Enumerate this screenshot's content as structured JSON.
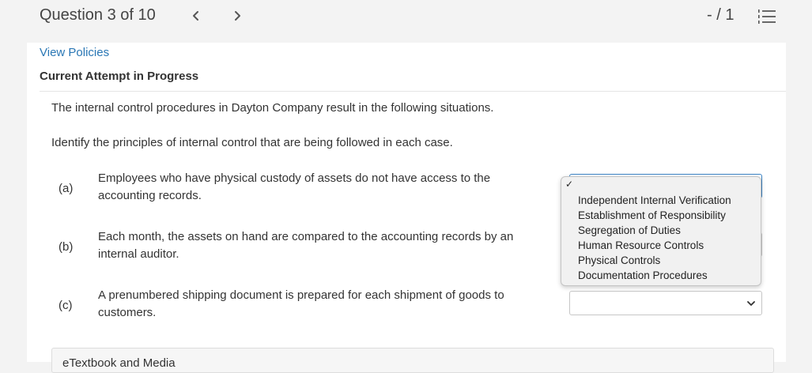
{
  "header": {
    "question_counter": "Question 3 of 10",
    "score": "- / 1",
    "prev_icon": "chevron-left-icon",
    "next_icon": "chevron-right-icon",
    "list_icon": "numbered-list-icon"
  },
  "panel": {
    "view_policies": "View Policies",
    "attempt_status": "Current Attempt in Progress"
  },
  "question": {
    "intro1": "The internal control procedures in Dayton Company result in the following situations.",
    "intro2": "Identify the principles of internal control that are being followed in each case.",
    "parts": [
      {
        "label": "(a)",
        "line1": "Employees who have physical custody of assets do not have access to the",
        "line2": "accounting records.",
        "selected": ""
      },
      {
        "label": "(b)",
        "line1": "Each month, the assets on hand are compared to the accounting records by an",
        "line2": "internal auditor.",
        "selected": ""
      },
      {
        "label": "(c)",
        "line1": "A prenumbered shipping document is prepared for each shipment of goods to",
        "line2": "customers.",
        "selected": ""
      }
    ],
    "ebook_label": "eTextbook and Media"
  },
  "dropdown": {
    "checkmark": "✓",
    "options": [
      "Independent Internal Verification",
      "Establishment of Responsibility",
      "Segregation of Duties",
      "Human Resource Controls",
      "Physical Controls",
      "Documentation Procedures"
    ]
  },
  "colors": {
    "link": "#2a77b5",
    "focus": "#3b83c4",
    "background": "#f3f3f3"
  }
}
